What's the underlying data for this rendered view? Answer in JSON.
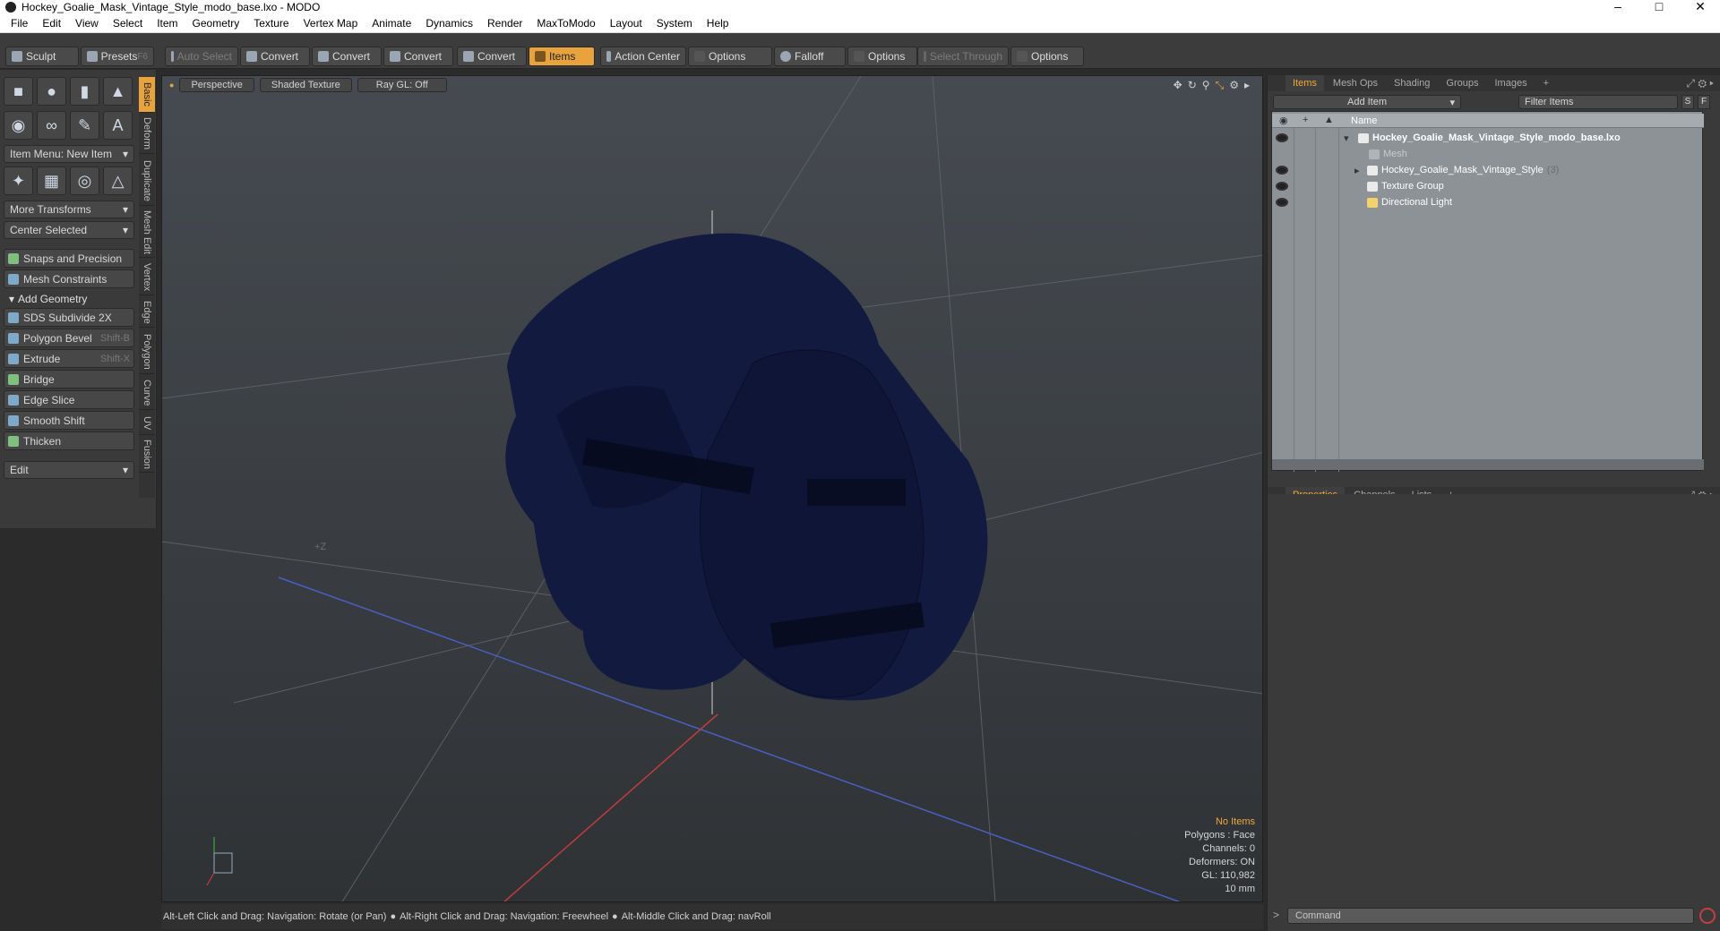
{
  "window": {
    "title": "Hockey_Goalie_Mask_Vintage_Style_modo_base.lxo - MODO"
  },
  "menu": [
    "File",
    "Edit",
    "View",
    "Select",
    "Item",
    "Geometry",
    "Texture",
    "Vertex Map",
    "Animate",
    "Dynamics",
    "Render",
    "MaxToModo",
    "Layout",
    "System",
    "Help"
  ],
  "toolbar": {
    "sculpt": "Sculpt",
    "presets": "Presets",
    "presets_key": "F6",
    "auto_select": "Auto Select",
    "convert1": "Convert",
    "convert2": "Convert",
    "convert3": "Convert",
    "convert4": "Convert",
    "items": "Items",
    "action_center": "Action Center",
    "options1": "Options",
    "falloff": "Falloff",
    "options2": "Options",
    "select_through": "Select Through",
    "options3": "Options"
  },
  "left": {
    "item_menu": "Item Menu: New Item",
    "more_transforms": "More Transforms",
    "center_selected": "Center Selected",
    "snaps": "Snaps and Precision",
    "mesh_constraints": "Mesh Constraints",
    "add_geometry": "Add Geometry",
    "tools": [
      {
        "label": "SDS Subdivide 2X",
        "shortcut": ""
      },
      {
        "label": "Polygon Bevel",
        "shortcut": "Shift-B"
      },
      {
        "label": "Extrude",
        "shortcut": "Shift-X"
      },
      {
        "label": "Bridge",
        "shortcut": ""
      },
      {
        "label": "Edge Slice",
        "shortcut": ""
      },
      {
        "label": "Smooth Shift",
        "shortcut": ""
      },
      {
        "label": "Thicken",
        "shortcut": ""
      }
    ],
    "edit": "Edit",
    "vtabs": [
      "Basic",
      "Deform",
      "Duplicate",
      "Mesh Edit",
      "Vertex",
      "Edge",
      "Polygon",
      "Curve",
      "UV",
      "Fusion"
    ]
  },
  "viewport": {
    "perspective": "Perspective",
    "shaded": "Shaded Texture",
    "raygl": "Ray GL: Off",
    "info": {
      "items": "No Items",
      "polygons": "Polygons : Face",
      "channels": "Channels: 0",
      "deformers": "Deformers: ON",
      "gl": "GL: 110,982",
      "scale": "10 mm"
    },
    "grid_label": "+Z"
  },
  "status": {
    "hint1": "Alt-Left Click and Drag: Navigation: Rotate (or Pan)",
    "hint2": "Alt-Right Click and Drag: Navigation: Freewheel",
    "hint3": "Alt-Middle Click and Drag: navRoll"
  },
  "right": {
    "tabs": [
      "Items",
      "Mesh Ops",
      "Shading",
      "Groups",
      "Images"
    ],
    "add_item": "Add Item",
    "filter": "Filter Items",
    "filter_s": "S",
    "filter_f": "F",
    "col_name": "Name",
    "tree": [
      {
        "label": "Hockey_Goalie_Mask_Vintage_Style_modo_base.lxo",
        "count": ""
      },
      {
        "label": "Mesh",
        "count": ""
      },
      {
        "label": "Hockey_Goalie_Mask_Vintage_Style",
        "count": "(3)"
      },
      {
        "label": "Texture Group",
        "count": ""
      },
      {
        "label": "Directional Light",
        "count": ""
      }
    ],
    "bottom_tabs": [
      "Properties",
      "Channels",
      "Lists"
    ],
    "command_placeholder": "Command"
  }
}
